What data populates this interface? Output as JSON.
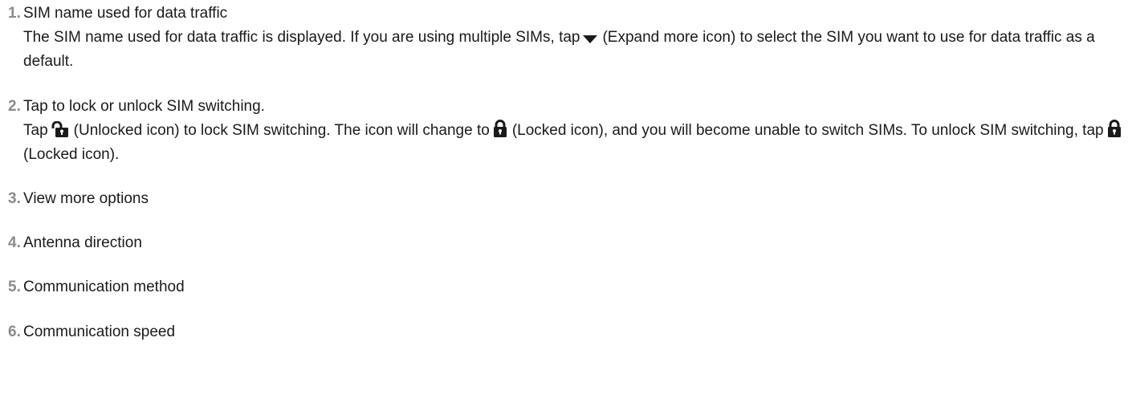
{
  "items": [
    {
      "number": "1.",
      "title": "SIM name used for data traffic",
      "desc_a": "The SIM name used for data traffic is displayed. If you are using multiple SIMs, tap",
      "desc_b": "(Expand more icon) to select the SIM you want to use for data traffic as a default."
    },
    {
      "number": "2.",
      "title": "Tap to lock or unlock SIM switching.",
      "desc_a": "Tap",
      "desc_b": "(Unlocked icon) to lock SIM switching. The icon will change to",
      "desc_c": "(Locked icon), and you will become unable to switch SIMs. To unlock SIM switching, tap",
      "desc_d": "(Locked icon)."
    },
    {
      "number": "3.",
      "title": "View more options"
    },
    {
      "number": "4.",
      "title": "Antenna direction"
    },
    {
      "number": "5.",
      "title": "Communication method"
    },
    {
      "number": "6.",
      "title": "Communication speed"
    }
  ],
  "icons": {
    "expand": "expand-more-icon",
    "unlocked": "unlocked-icon",
    "locked": "locked-icon"
  },
  "colors": {
    "number": "#8c8c8c",
    "text": "#1a1a1a",
    "icon": "#1a1a1a"
  }
}
